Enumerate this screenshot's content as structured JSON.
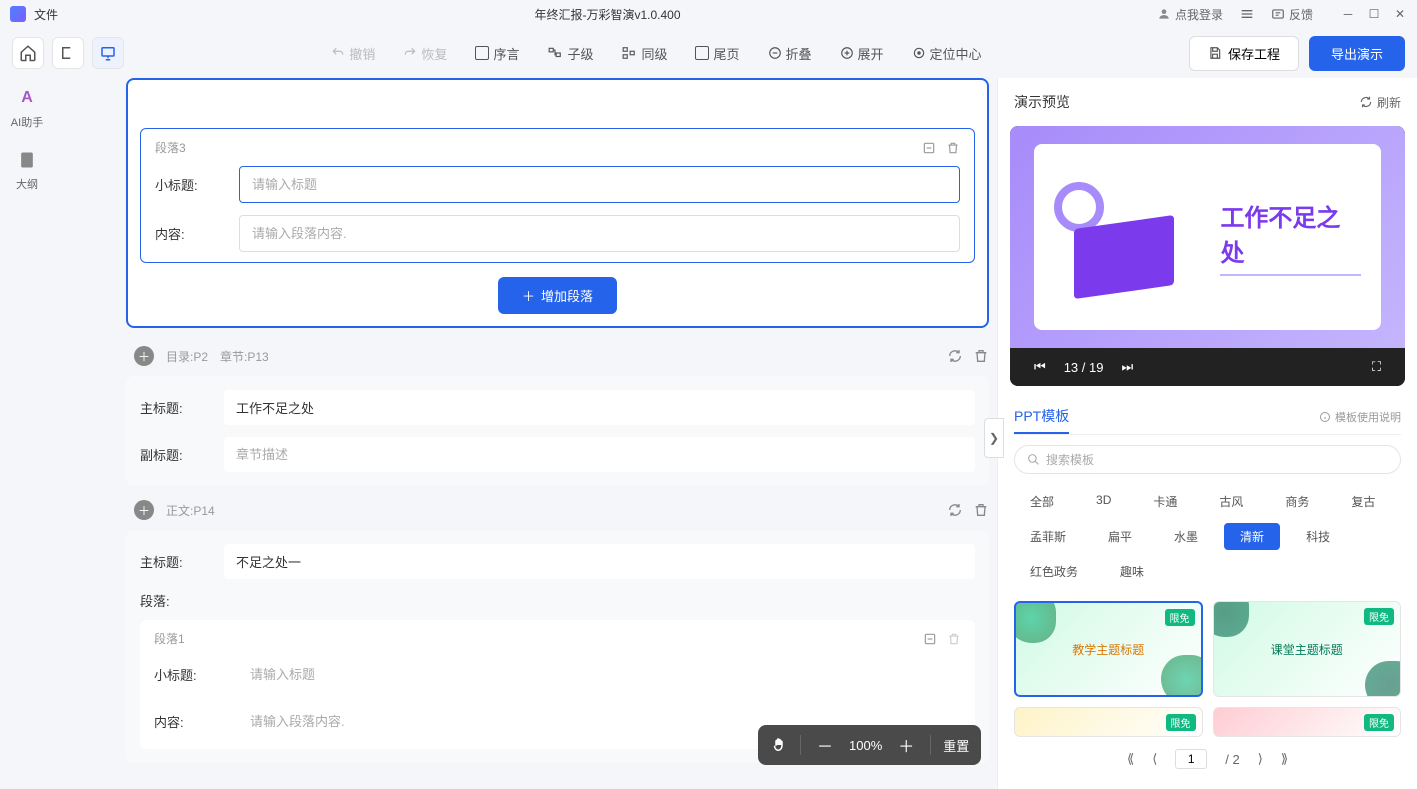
{
  "titlebar": {
    "fileMenu": "文件",
    "appTitle": "年终汇报-万彩智演v1.0.400",
    "login": "点我登录",
    "feedback": "反馈"
  },
  "toolbar": {
    "undo": "撤销",
    "redo": "恢复",
    "preface": "序言",
    "child": "子级",
    "sibling": "同级",
    "tail": "尾页",
    "collapse": "折叠",
    "expand": "展开",
    "locate": "定位中心",
    "save": "保存工程",
    "export": "导出演示"
  },
  "sidebar": {
    "ai": "AI助手",
    "outline": "大纲"
  },
  "content": {
    "para3": {
      "label": "段落3",
      "subtitleLabel": "小标题:",
      "subtitlePh": "请输入标题",
      "contentLabel": "内容:",
      "contentPh": "请输入段落内容.",
      "addBtn": "增加段落"
    },
    "sectionMeta1": {
      "catalog": "目录:P2",
      "chapter": "章节:P13"
    },
    "chapterCard": {
      "mainTitleLabel": "主标题:",
      "mainTitle": "工作不足之处",
      "subTitleLabel": "副标题:",
      "subTitlePh": "章节描述"
    },
    "sectionMeta2": {
      "body": "正文:P14"
    },
    "bodyCard": {
      "mainTitleLabel": "主标题:",
      "mainTitle": "不足之处一",
      "paraLabel": "段落:",
      "para1Label": "段落1",
      "subtitleLabel": "小标题:",
      "subtitlePh": "请输入标题",
      "contentLabel": "内容:",
      "contentPh": "请输入段落内容."
    }
  },
  "preview": {
    "title": "演示预览",
    "refresh": "刷新",
    "slideTitle": "工作不足之处",
    "pageIndicator": "13 / 19"
  },
  "templates": {
    "tab": "PPT模板",
    "help": "模板使用说明",
    "searchPh": "搜索模板",
    "tags": [
      "全部",
      "3D",
      "卡通",
      "古风",
      "商务",
      "复古",
      "孟菲斯",
      "扁平",
      "水墨",
      "清新",
      "科技",
      "红色政务",
      "趣味"
    ],
    "activeTag": "清新",
    "badge": "限免",
    "tpl1Text": "教学主题标题",
    "tpl2Text": "课堂主题标题",
    "pageCurrent": "1",
    "pageTotal": "/ 2"
  },
  "zoom": {
    "percent": "100%",
    "reset": "重置"
  }
}
